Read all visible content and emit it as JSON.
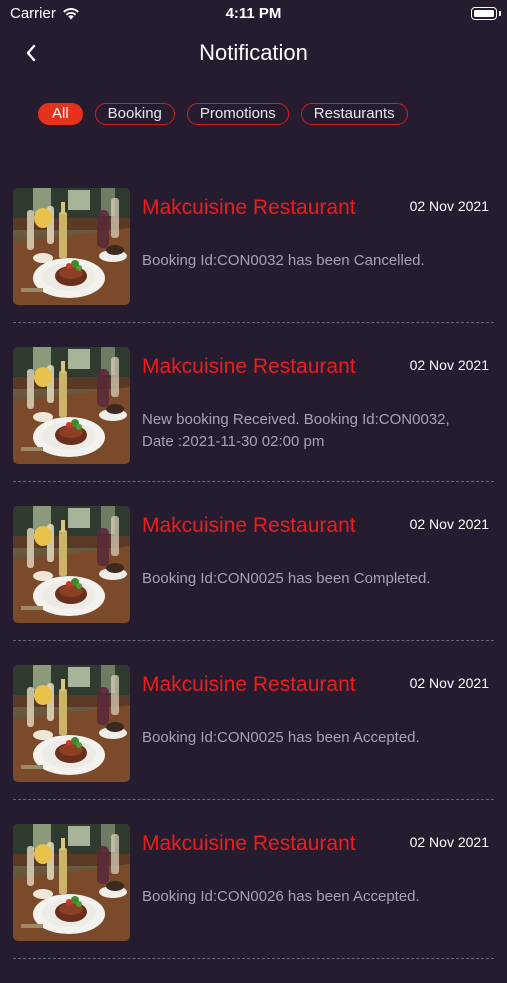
{
  "status_bar": {
    "carrier": "Carrier",
    "time": "4:11 PM"
  },
  "header": {
    "title": "Notification"
  },
  "filters": [
    {
      "label": "All",
      "active": true
    },
    {
      "label": "Booking",
      "active": false
    },
    {
      "label": "Promotions",
      "active": false
    },
    {
      "label": "Restaurants",
      "active": false
    }
  ],
  "notifications": [
    {
      "restaurant": "Makcuisine Restaurant",
      "date": "02 Nov 2021",
      "message": "Booking Id:CON0032 has been Cancelled."
    },
    {
      "restaurant": "Makcuisine Restaurant",
      "date": "02 Nov 2021",
      "message": "New booking Received. Booking Id:CON0032, Date :2021-11-30 02:00 pm"
    },
    {
      "restaurant": "Makcuisine Restaurant",
      "date": "02 Nov 2021",
      "message": "Booking Id:CON0025 has been Completed."
    },
    {
      "restaurant": "Makcuisine Restaurant",
      "date": "02 Nov 2021",
      "message": "Booking Id:CON0025 has been Accepted."
    },
    {
      "restaurant": "Makcuisine Restaurant",
      "date": "02 Nov 2021",
      "message": "Booking Id:CON0026 has been Accepted."
    }
  ]
}
